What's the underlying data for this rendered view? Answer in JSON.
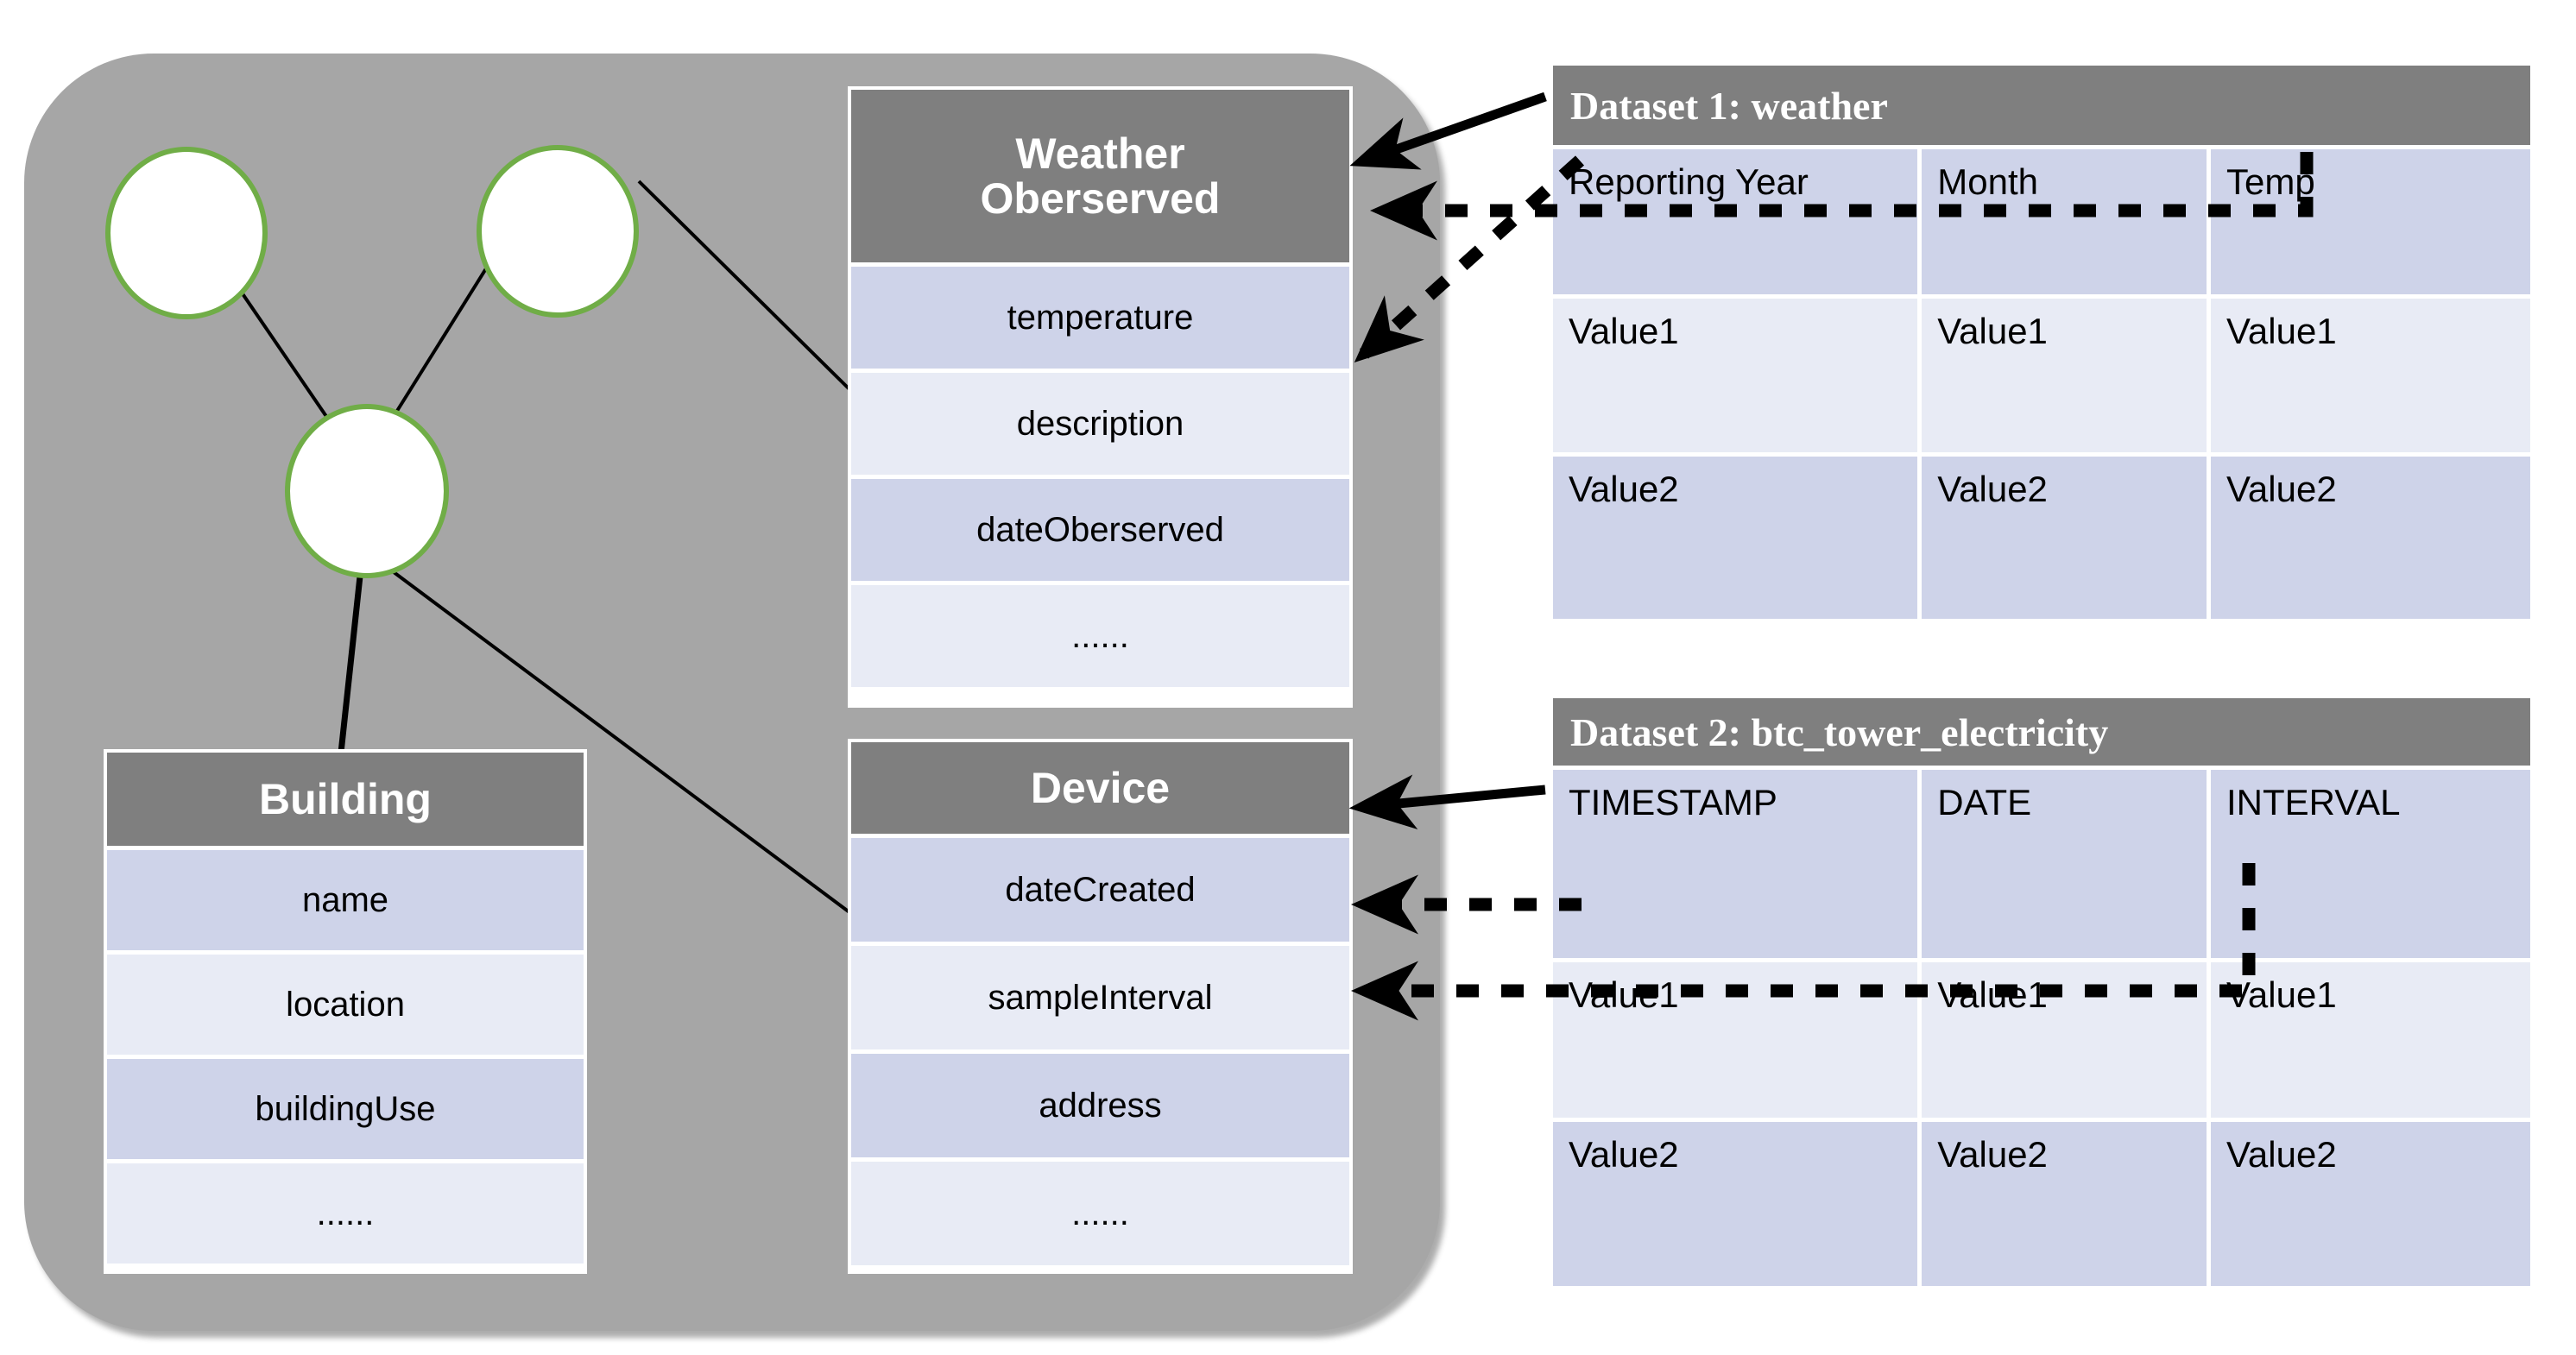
{
  "diagram": {
    "container_label": "ontology-knowledge-graph-panel",
    "colors": {
      "panel_gray": "#a6a6a6",
      "header_gray": "#7f7f7f",
      "row_dark_blue": "#ced3e9",
      "row_light_blue": "#e8ebf5",
      "node_green": "#70ad47",
      "line_black": "#000000"
    }
  },
  "nodes": [
    {
      "id": "node-top-left",
      "label": ""
    },
    {
      "id": "node-top-right",
      "label": ""
    },
    {
      "id": "node-center",
      "label": ""
    }
  ],
  "entities": [
    {
      "id": "weather-observed",
      "title": "Weather Oberserved",
      "title_lines": [
        "Weather",
        "Oberserved"
      ],
      "attributes": [
        "temperature",
        "description",
        "dateOberserved",
        "......"
      ]
    },
    {
      "id": "building",
      "title": "Building",
      "title_lines": [
        "Building"
      ],
      "attributes": [
        "name",
        "location",
        "buildingUse",
        "......"
      ]
    },
    {
      "id": "device",
      "title": "Device",
      "title_lines": [
        "Device"
      ],
      "attributes": [
        "dateCreated",
        "sampleInterval",
        "address",
        "......"
      ]
    }
  ],
  "datasets": [
    {
      "id": "dataset-1",
      "title": "Dataset 1: weather",
      "columns": [
        "Reporting Year",
        "Month",
        "Temp"
      ],
      "rows": [
        [
          "Value1",
          "Value1",
          "Value1"
        ],
        [
          "Value2",
          "Value2",
          "Value2"
        ]
      ]
    },
    {
      "id": "dataset-2",
      "title": "Dataset 2: btc_tower_electricity",
      "columns": [
        "TIMESTAMP",
        "DATE",
        "INTERVAL"
      ],
      "rows": [
        [
          "Value1",
          "Value1",
          "Value1"
        ],
        [
          "Value2",
          "Value2",
          "Value2"
        ]
      ]
    }
  ],
  "mappings": [
    {
      "from": "dataset-1.title",
      "to": "weather-observed.header",
      "style": "solid-arrow"
    },
    {
      "from": "dataset-1.Temp",
      "to": "weather-observed.temperature",
      "style": "dotted-arrow"
    },
    {
      "from": "dataset-1.Reporting Year",
      "to": "weather-observed.dateOberserved",
      "style": "dotted-arrow"
    },
    {
      "from": "dataset-2.title",
      "to": "device.header",
      "style": "solid-arrow"
    },
    {
      "from": "dataset-2.TIMESTAMP",
      "to": "device.dateCreated",
      "style": "dotted-arrow"
    },
    {
      "from": "dataset-2.INTERVAL",
      "to": "device.sampleInterval",
      "style": "dotted-arrow"
    }
  ]
}
